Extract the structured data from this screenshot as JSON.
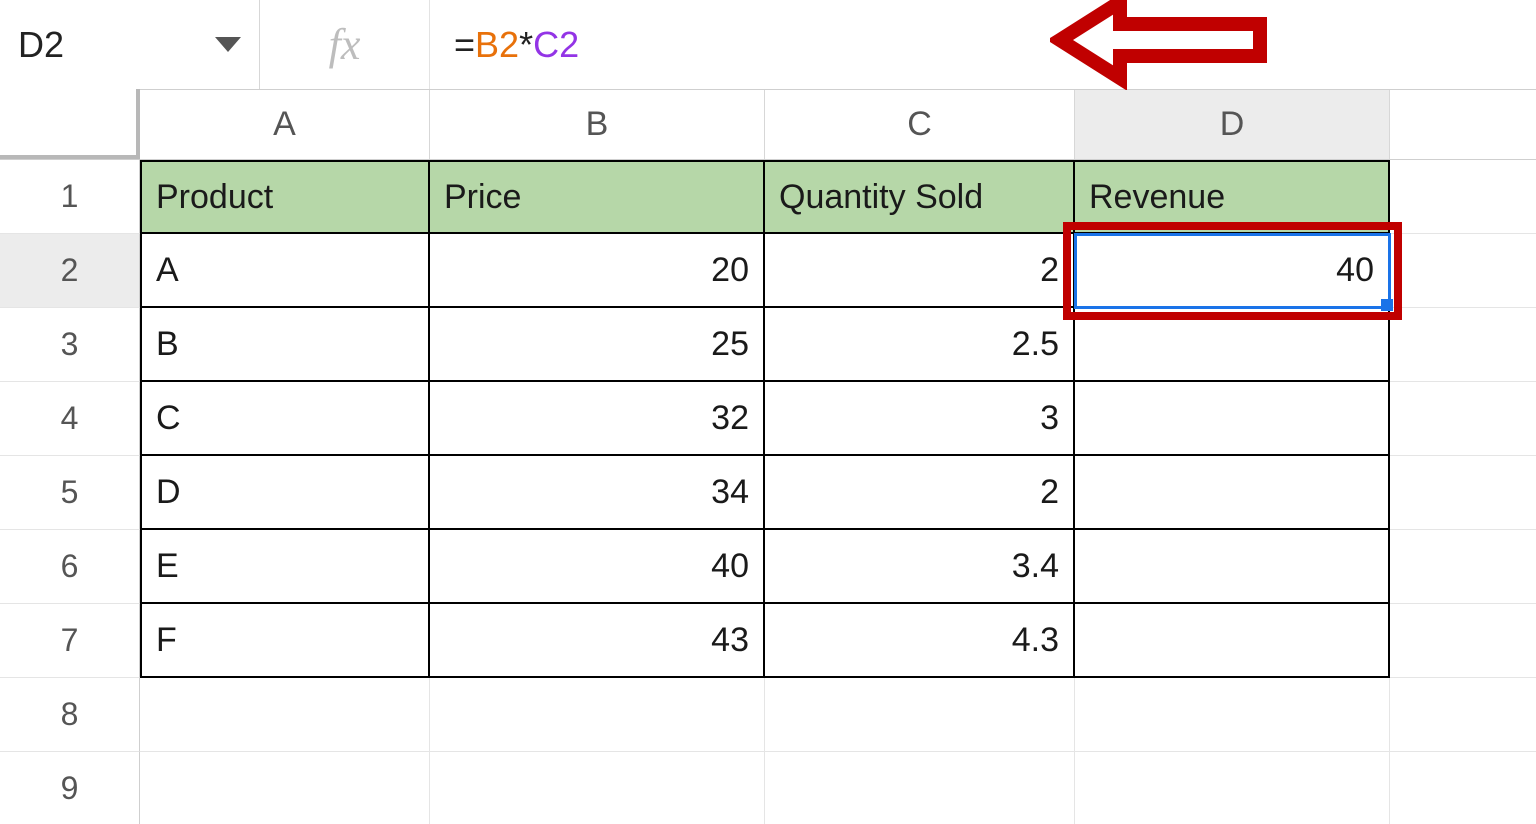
{
  "name_box": {
    "value": "D2"
  },
  "fx_label": "fx",
  "formula": {
    "eq": "=",
    "ref1": "B2",
    "op": "*",
    "ref2": "C2"
  },
  "columns": [
    "A",
    "B",
    "C",
    "D"
  ],
  "row_numbers": [
    "1",
    "2",
    "3",
    "4",
    "5",
    "6",
    "7",
    "8",
    "9"
  ],
  "headers": {
    "A": "Product",
    "B": "Price",
    "C": "Quantity Sold",
    "D": "Revenue"
  },
  "rows": [
    {
      "A": "A",
      "B": "20",
      "C": "2",
      "D": "40"
    },
    {
      "A": "B",
      "B": "25",
      "C": "2.5",
      "D": ""
    },
    {
      "A": "C",
      "B": "32",
      "C": "3",
      "D": ""
    },
    {
      "A": "D",
      "B": "34",
      "C": "2",
      "D": ""
    },
    {
      "A": "E",
      "B": "40",
      "C": "3.4",
      "D": ""
    },
    {
      "A": "F",
      "B": "43",
      "C": "4.3",
      "D": ""
    }
  ],
  "selected_cell": "D2",
  "colors": {
    "header_fill": "#b6d7a8",
    "selection": "#1a73e8",
    "annotation": "#c00000",
    "ref1": "#e8710a",
    "ref2": "#9334e6"
  }
}
